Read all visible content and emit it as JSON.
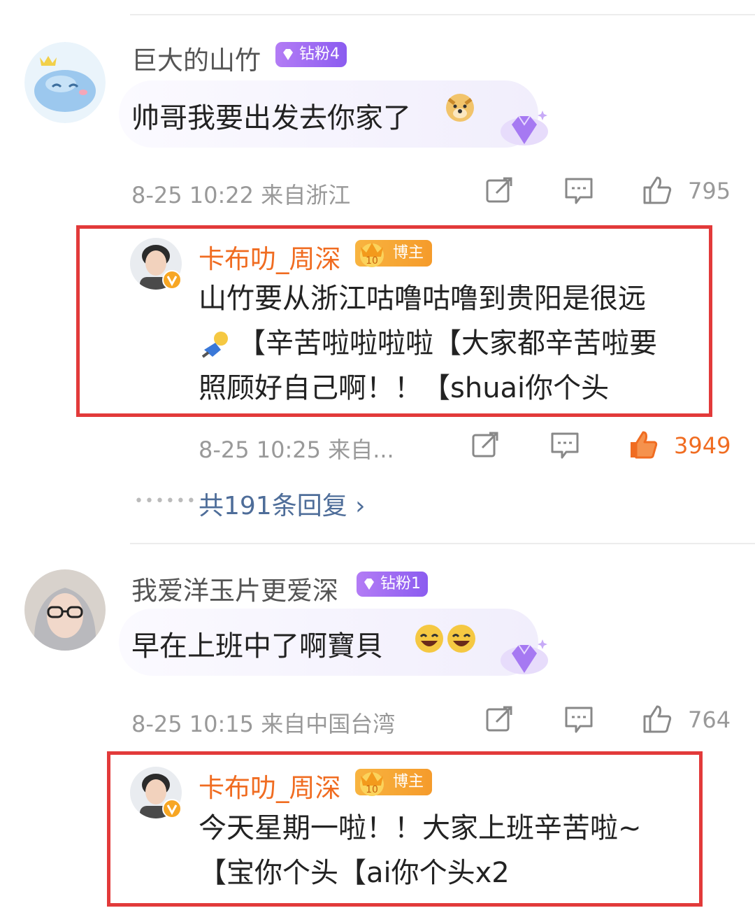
{
  "colors": {
    "blogger_name": "#f06c21",
    "like_active": "#f06c21",
    "red_box": "#e23a3a",
    "fan_badge": "#9b6cf3",
    "reply_link": "#4e6d99"
  },
  "comments": [
    {
      "username": "巨大的山竹",
      "fan_badge": "钻粉4",
      "text": "帅哥我要出发去你家了",
      "emoji": "doge-emoji",
      "meta": "8-25 10:22  来自浙江",
      "likes": "795",
      "reply": {
        "username": "卡布叻_周深",
        "badge": "博主",
        "lines": [
          "山竹要从浙江咕噜咕噜到贵阳是很远",
          "【辛苦啦啦啦啦【大家都辛苦啦要",
          "照顾好自己啊！！【shuai你个头"
        ],
        "meta": "8-25 10:25  来自...",
        "likes": "3949"
      },
      "more_replies": "共191条回复 ›"
    },
    {
      "username": "我爱洋玉片更爱深",
      "fan_badge": "钻粉1",
      "text": "早在上班中了啊寶貝",
      "emoji": "laugh-emoji",
      "meta": "8-25 10:15  来自中国台湾",
      "likes": "764",
      "reply": {
        "username": "卡布叻_周深",
        "badge": "博主",
        "lines": [
          "今天星期一啦！！大家上班辛苦啦~",
          "【宝你个头【ai你个头x2"
        ]
      }
    }
  ]
}
